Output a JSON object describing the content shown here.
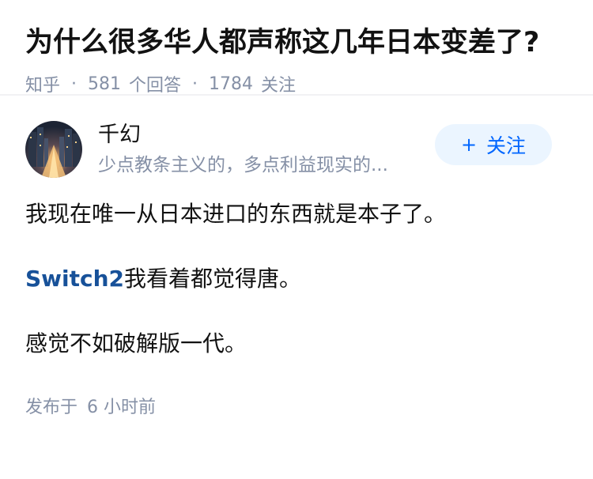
{
  "question": {
    "title": "为什么很多华人都声称这几年日本变差了?",
    "source": "知乎",
    "separator": "·",
    "answer_count": "581",
    "answer_label": "个回答",
    "follower_count": "1784",
    "follower_label": "关注"
  },
  "author": {
    "name": "千幻",
    "signature": "少点教条主义的，多点利益现实的...",
    "follow_plus": "+",
    "follow_label": "关注",
    "avatar_icon": "city-night-avatar"
  },
  "content": {
    "para1": "我现在唯一从日本进口的东西就是本子了。",
    "link_text": "Switch2",
    "para2_rest": "我看着都觉得唐。",
    "para3": "感觉不如破解版一代。"
  },
  "footer": {
    "published_label": "发布于",
    "published_time": "6 小时前"
  },
  "colors": {
    "meta_gray": "#8590a6",
    "link_blue": "#175199",
    "follow_blue": "#0066ff",
    "follow_bg": "#ebf5ff"
  }
}
